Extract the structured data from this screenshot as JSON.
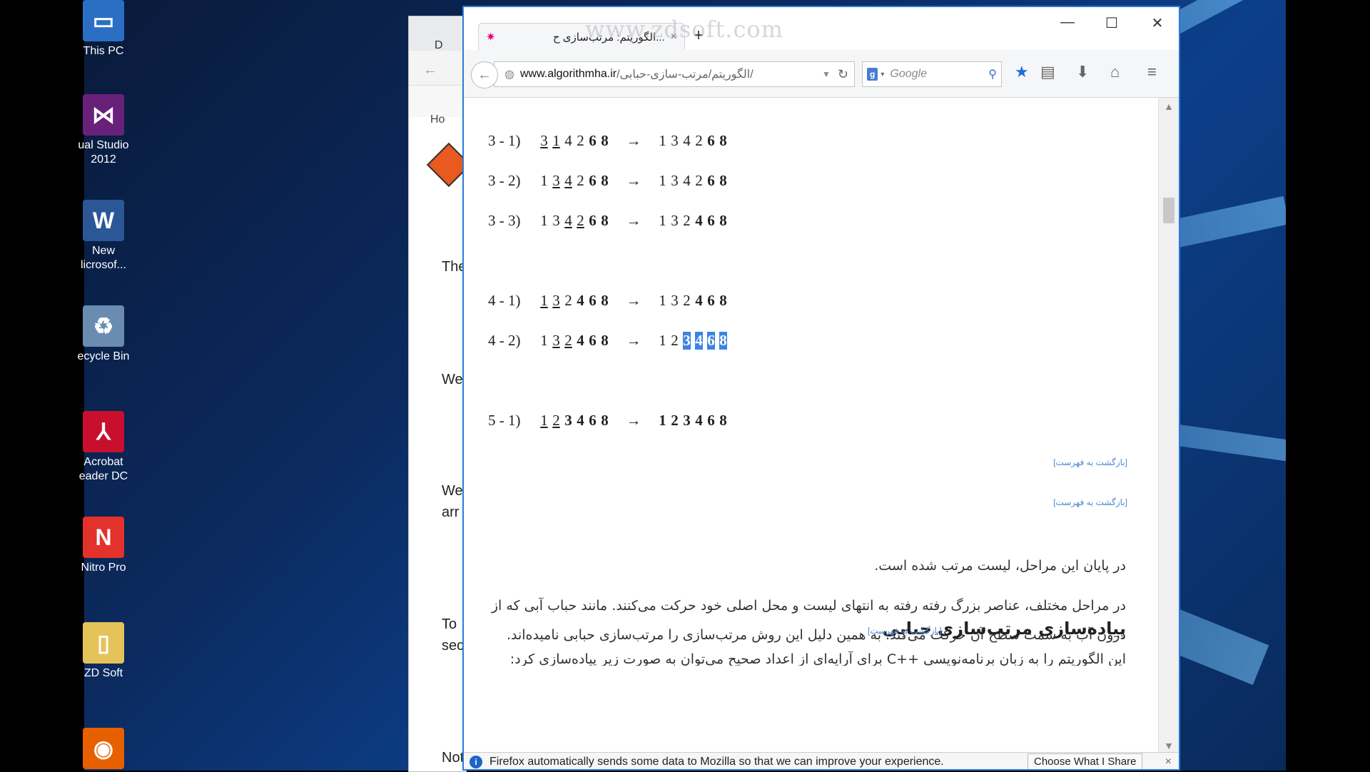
{
  "desktop": {
    "icons": [
      {
        "label1": "This PC",
        "label2": "",
        "icon": "computer-icon",
        "color": "#2b6fc4"
      },
      {
        "label1": "ual Studio",
        "label2": "2012",
        "icon": "visual-studio-icon",
        "color": "#68217a"
      },
      {
        "label1": "New",
        "label2": "licrosof...",
        "icon": "word-document-icon",
        "color": "#2b5797"
      },
      {
        "label1": "ecycle Bin",
        "label2": "",
        "icon": "recycle-bin-icon",
        "color": "#6a8cb0"
      },
      {
        "label1": "Acrobat",
        "label2": "eader DC",
        "icon": "acrobat-icon",
        "color": "#c8102e"
      },
      {
        "label1": "Nitro Pro",
        "label2": "",
        "icon": "nitro-pro-icon",
        "color": "#e2322b"
      },
      {
        "label1": "ZD Soft",
        "label2": "",
        "icon": "folder-icon",
        "color": "#e6c25a"
      },
      {
        "label1": "",
        "label2": "",
        "icon": "firefox-icon",
        "color": "#e66000"
      }
    ]
  },
  "back_window": {
    "tab_letter": "D",
    "nav_home": "Ho",
    "texts": [
      "The",
      "We",
      "We",
      "arr",
      "To",
      "sec",
      "Not"
    ]
  },
  "browser": {
    "watermark": "www.zdsoft.com",
    "tab_title": "...الگوریتم: مرتب‌سازی ح",
    "tab_close": "×",
    "new_tab": "+",
    "controls": {
      "minimize": "—",
      "maximize": "☐",
      "close": "✕"
    },
    "url": {
      "host": "www.algorithmha.ir",
      "path": "/الگوریتم/مرتب-سازی-حبابی/"
    },
    "search_placeholder": "Google",
    "search_engine_badge": "g"
  },
  "content": {
    "rows": [
      {
        "label": "3 - 1)",
        "left": [
          [
            "3",
            "u"
          ],
          [
            "1",
            "u"
          ],
          [
            "4",
            ""
          ],
          [
            "2",
            ""
          ],
          [
            "6",
            "b"
          ],
          [
            "8",
            "b"
          ]
        ],
        "right": [
          [
            "1",
            ""
          ],
          [
            "3",
            ""
          ],
          [
            "4",
            ""
          ],
          [
            "2",
            ""
          ],
          [
            "6",
            "b"
          ],
          [
            "8",
            "b"
          ]
        ]
      },
      {
        "label": "3 - 2)",
        "left": [
          [
            "1",
            ""
          ],
          [
            "3",
            "u"
          ],
          [
            "4",
            "u"
          ],
          [
            "2",
            ""
          ],
          [
            "6",
            "b"
          ],
          [
            "8",
            "b"
          ]
        ],
        "right": [
          [
            "1",
            ""
          ],
          [
            "3",
            ""
          ],
          [
            "4",
            ""
          ],
          [
            "2",
            ""
          ],
          [
            "6",
            "b"
          ],
          [
            "8",
            "b"
          ]
        ]
      },
      {
        "label": "3 - 3)",
        "left": [
          [
            "1",
            ""
          ],
          [
            "3",
            ""
          ],
          [
            "4",
            "u"
          ],
          [
            "2",
            "u"
          ],
          [
            "6",
            "b"
          ],
          [
            "8",
            "b"
          ]
        ],
        "right": [
          [
            "1",
            ""
          ],
          [
            "3",
            ""
          ],
          [
            "2",
            ""
          ],
          [
            "4",
            "b"
          ],
          [
            "6",
            "b"
          ],
          [
            "8",
            "b"
          ]
        ]
      },
      {
        "label": "4 - 1)",
        "left": [
          [
            "1",
            "u"
          ],
          [
            "3",
            "u"
          ],
          [
            "2",
            ""
          ],
          [
            "4",
            "b"
          ],
          [
            "6",
            "b"
          ],
          [
            "8",
            "b"
          ]
        ],
        "right": [
          [
            "1",
            ""
          ],
          [
            "3",
            ""
          ],
          [
            "2",
            ""
          ],
          [
            "4",
            "b"
          ],
          [
            "6",
            "b"
          ],
          [
            "8",
            "b"
          ]
        ]
      },
      {
        "label": "4 - 2)",
        "left": [
          [
            "1",
            ""
          ],
          [
            "3",
            "u"
          ],
          [
            "2",
            "u"
          ],
          [
            "4",
            "b"
          ],
          [
            "6",
            "b"
          ],
          [
            "8",
            "b"
          ]
        ],
        "right": [
          [
            "1",
            ""
          ],
          [
            "2",
            ""
          ],
          [
            "3",
            "bh"
          ],
          [
            "4",
            "bh"
          ],
          [
            "6",
            "bh"
          ],
          [
            "8",
            "bh"
          ]
        ]
      },
      {
        "label": "5 - 1)",
        "left": [
          [
            "1",
            "u"
          ],
          [
            "2",
            "u"
          ],
          [
            "3",
            "b"
          ],
          [
            "4",
            "b"
          ],
          [
            "6",
            "b"
          ],
          [
            "8",
            "b"
          ]
        ],
        "right": [
          [
            "1",
            "b"
          ],
          [
            "2",
            "b"
          ],
          [
            "3",
            "b"
          ],
          [
            "4",
            "b"
          ],
          [
            "6",
            "b"
          ],
          [
            "8",
            "b"
          ]
        ]
      }
    ],
    "arrow": "→",
    "back_to_index": "[بازگشت به فهرست]",
    "para1": "در پایان این مراحل، لیست مرتب شده است.",
    "para2": "در مراحل مختلف، عناصر بزرگ رفته رفته به انتهای لیست و محل اصلی خود حرکت می‌کنند. مانند حباب آبی که از درون آب به سمت سطح آن حرکت می‌کند. به همین دلیل این روش مرتب‌سازی را مرتب‌سازی حبابی نامیده‌اند.",
    "heading": "پیاده‌سازی مرتب‌سازی حبابی",
    "cut_line": "این الگوریتم را به زبان برنامه‌نویسی ++C برای آرایه‌ای از اعداد صحیح می‌توان به صورت زیر پیاده‌سازی کرد:"
  },
  "notification": {
    "text": "Firefox automatically sends some data to Mozilla so that we can improve your experience.",
    "button": "Choose What I Share",
    "close": "×"
  }
}
